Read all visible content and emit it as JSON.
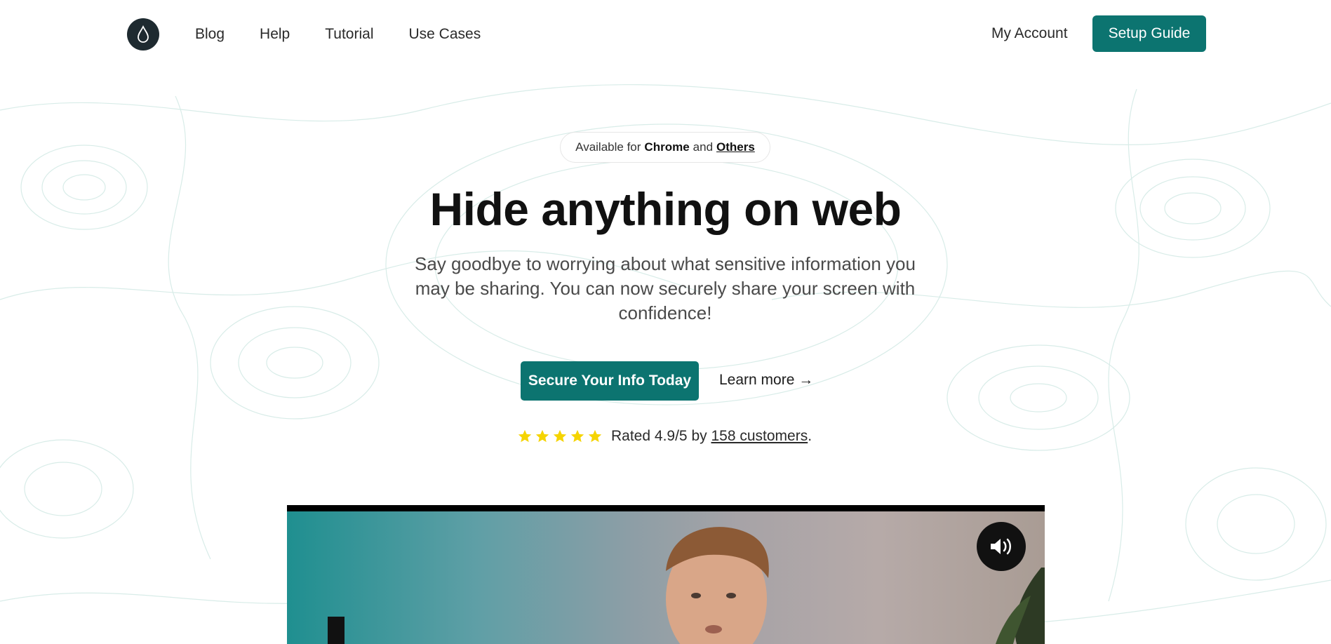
{
  "header": {
    "logo_icon": "water-drop-icon",
    "nav": [
      "Blog",
      "Help",
      "Tutorial",
      "Use Cases"
    ],
    "account_label": "My Account",
    "setup_label": "Setup Guide"
  },
  "hero": {
    "availability": {
      "prefix": "Available for",
      "browser": "Chrome",
      "conj": "and",
      "others": "Others"
    },
    "headline": "Hide anything on web",
    "subtitle": "Say goodbye to worrying about what sensitive information you may be sharing. You can now securely share your screen with confidence!",
    "cta_primary": "Secure Your Info Today",
    "cta_secondary": "Learn more →",
    "rating": {
      "stars": 5,
      "prefix": "Rated",
      "score": "4.9",
      "suffix": "/5 by",
      "customers": "158 customers",
      "end": "."
    }
  },
  "video": {
    "mute_icon": "speaker-icon"
  },
  "colors": {
    "accent": "#0c7470",
    "star": "#f5d400",
    "logo_bg": "#1e2a30"
  }
}
